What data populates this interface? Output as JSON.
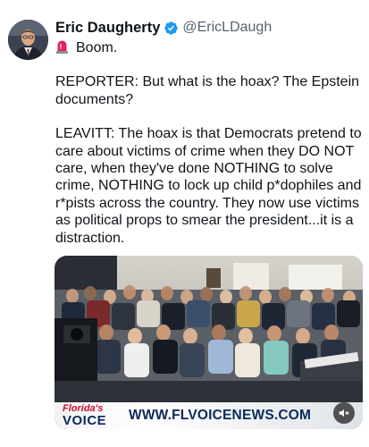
{
  "tweet": {
    "author": {
      "display_name": "Eric Daugherty",
      "handle": "@EricLDaugh",
      "verified": true,
      "avatar_icon": "profile-photo"
    },
    "lines": [
      "Boom.",
      "",
      "REPORTER: But what is the hoax? The Epstein documents?",
      "",
      "LEAVITT: The hoax is that Democrats pretend to care about victims of crime when they DO NOT care, when they've done NOTHING to solve crime, NOTHING to lock up child p*dophiles and r*pists across the country. They now use victims as political props to smear the president...it is a distraction."
    ],
    "leading_icon": "police-siren-icon",
    "media": {
      "type": "video",
      "watermark": {
        "logo_top": "Florida's",
        "logo_bottom": "VOICE",
        "site": "WWW.FLVOICENEWS.COM"
      },
      "mute_icon": "speaker-muted-icon"
    }
  },
  "colors": {
    "text": "#0f1419",
    "secondary": "#536471",
    "verified": "#1d9bf0",
    "brand_red": "#c8102e",
    "brand_navy": "#0a2a5c"
  }
}
